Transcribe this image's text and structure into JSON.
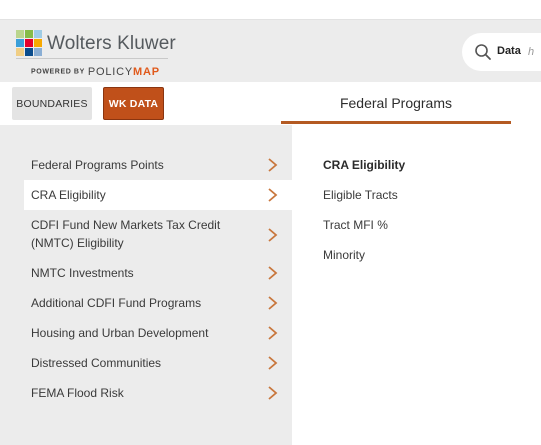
{
  "brand": {
    "name": "Wolters Kluwer",
    "powered_by": "POWERED BY",
    "policy": "POLICY",
    "map": "MAP",
    "accent": "#c0501a"
  },
  "search": {
    "scope": "Data",
    "placeholder": "h"
  },
  "tabs": {
    "boundaries": "BOUNDARIES",
    "wk_data": "WK DATA"
  },
  "section": {
    "title": "Federal Programs"
  },
  "menu": {
    "items": [
      {
        "label": "Federal Programs Points"
      },
      {
        "label": "CRA Eligibility"
      },
      {
        "label": "CDFI Fund New Markets Tax Credit (NMTC) Eligibility"
      },
      {
        "label": "NMTC Investments"
      },
      {
        "label": "Additional CDFI Fund Programs"
      },
      {
        "label": "Housing and Urban Development"
      },
      {
        "label": "Distressed Communities"
      },
      {
        "label": "FEMA Flood Risk"
      }
    ]
  },
  "submenu": {
    "items": [
      {
        "label": "CRA Eligibility"
      },
      {
        "label": "Eligible Tracts"
      },
      {
        "label": "Tract MFI %"
      },
      {
        "label": "Minority"
      }
    ]
  }
}
